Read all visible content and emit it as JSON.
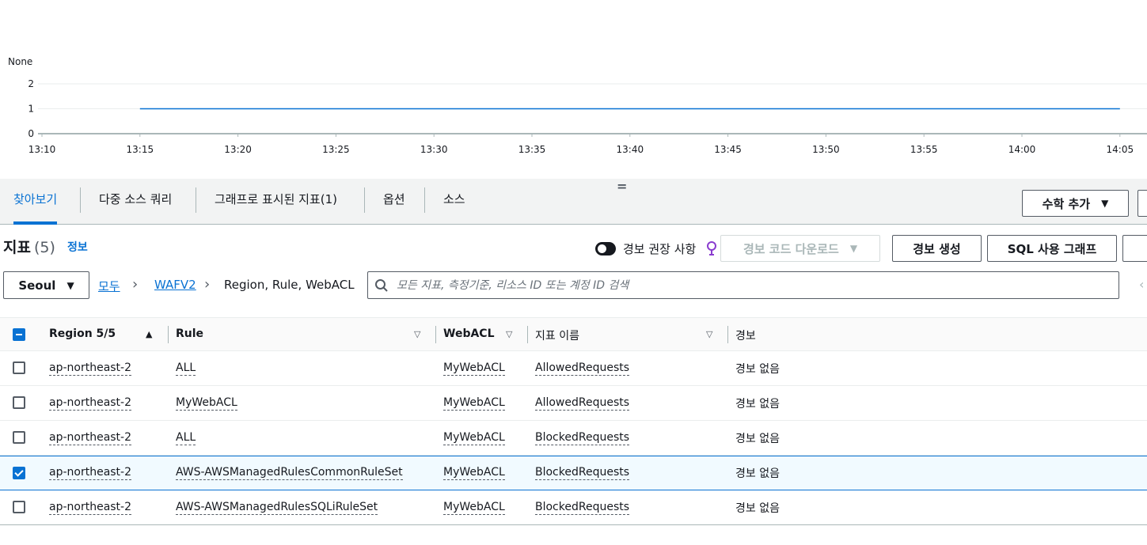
{
  "chart_data": {
    "type": "line",
    "unit_label": "None",
    "y_ticks": [
      0,
      1,
      2
    ],
    "ylim": [
      0,
      2
    ],
    "x_ticks": [
      "13:10",
      "13:15",
      "13:20",
      "13:25",
      "13:30",
      "13:35",
      "13:40",
      "13:45",
      "13:50",
      "13:55",
      "14:00",
      "14:05"
    ],
    "series": [
      {
        "x_start": "13:15",
        "x_end": "14:05",
        "value": 1,
        "color": "#0972d3"
      }
    ],
    "grid": true
  },
  "tabs": [
    {
      "label": "찾아보기",
      "active": true
    },
    {
      "label": "다중 소스 쿼리",
      "active": false
    },
    {
      "label": "그래프로 표시된 지표(1)",
      "active": false
    },
    {
      "label": "옵션",
      "active": false
    },
    {
      "label": "소스",
      "active": false
    }
  ],
  "add_math_button": {
    "label": "수학 추가"
  },
  "metrics": {
    "title": "지표",
    "count": "(5)",
    "info_link": "정보",
    "alarm_toggle_label": "경보 권장 사항",
    "download_alarm_code": "경보 코드 다운로드",
    "create_alarm": "경보 생성",
    "graph_with_sql": "SQL 사용 그래프"
  },
  "filter": {
    "region": "Seoul",
    "breadcrumb": [
      "모두",
      "WAFV2",
      "Region, Rule, WebACL"
    ],
    "search_placeholder": "모든 지표, 측정기준, 리소스 ID 또는 계정 ID 검색"
  },
  "table": {
    "columns": [
      "Region 5/5",
      "Rule",
      "WebACL",
      "지표 이름",
      "경보"
    ],
    "rows": [
      {
        "region": "ap-northeast-2",
        "rule": "ALL",
        "webacl": "MyWebACL",
        "metric": "AllowedRequests",
        "alarm": "경보 없음",
        "selected": false
      },
      {
        "region": "ap-northeast-2",
        "rule": "MyWebACL",
        "webacl": "MyWebACL",
        "metric": "AllowedRequests",
        "alarm": "경보 없음",
        "selected": false
      },
      {
        "region": "ap-northeast-2",
        "rule": "ALL",
        "webacl": "MyWebACL",
        "metric": "BlockedRequests",
        "alarm": "경보 없음",
        "selected": false
      },
      {
        "region": "ap-northeast-2",
        "rule": "AWS-AWSManagedRulesCommonRuleSet",
        "webacl": "MyWebACL",
        "metric": "BlockedRequests",
        "alarm": "경보 없음",
        "selected": true
      },
      {
        "region": "ap-northeast-2",
        "rule": "AWS-AWSManagedRulesSQLiRuleSet",
        "webacl": "MyWebACL",
        "metric": "BlockedRequests",
        "alarm": "경보 없음",
        "selected": false
      }
    ]
  }
}
